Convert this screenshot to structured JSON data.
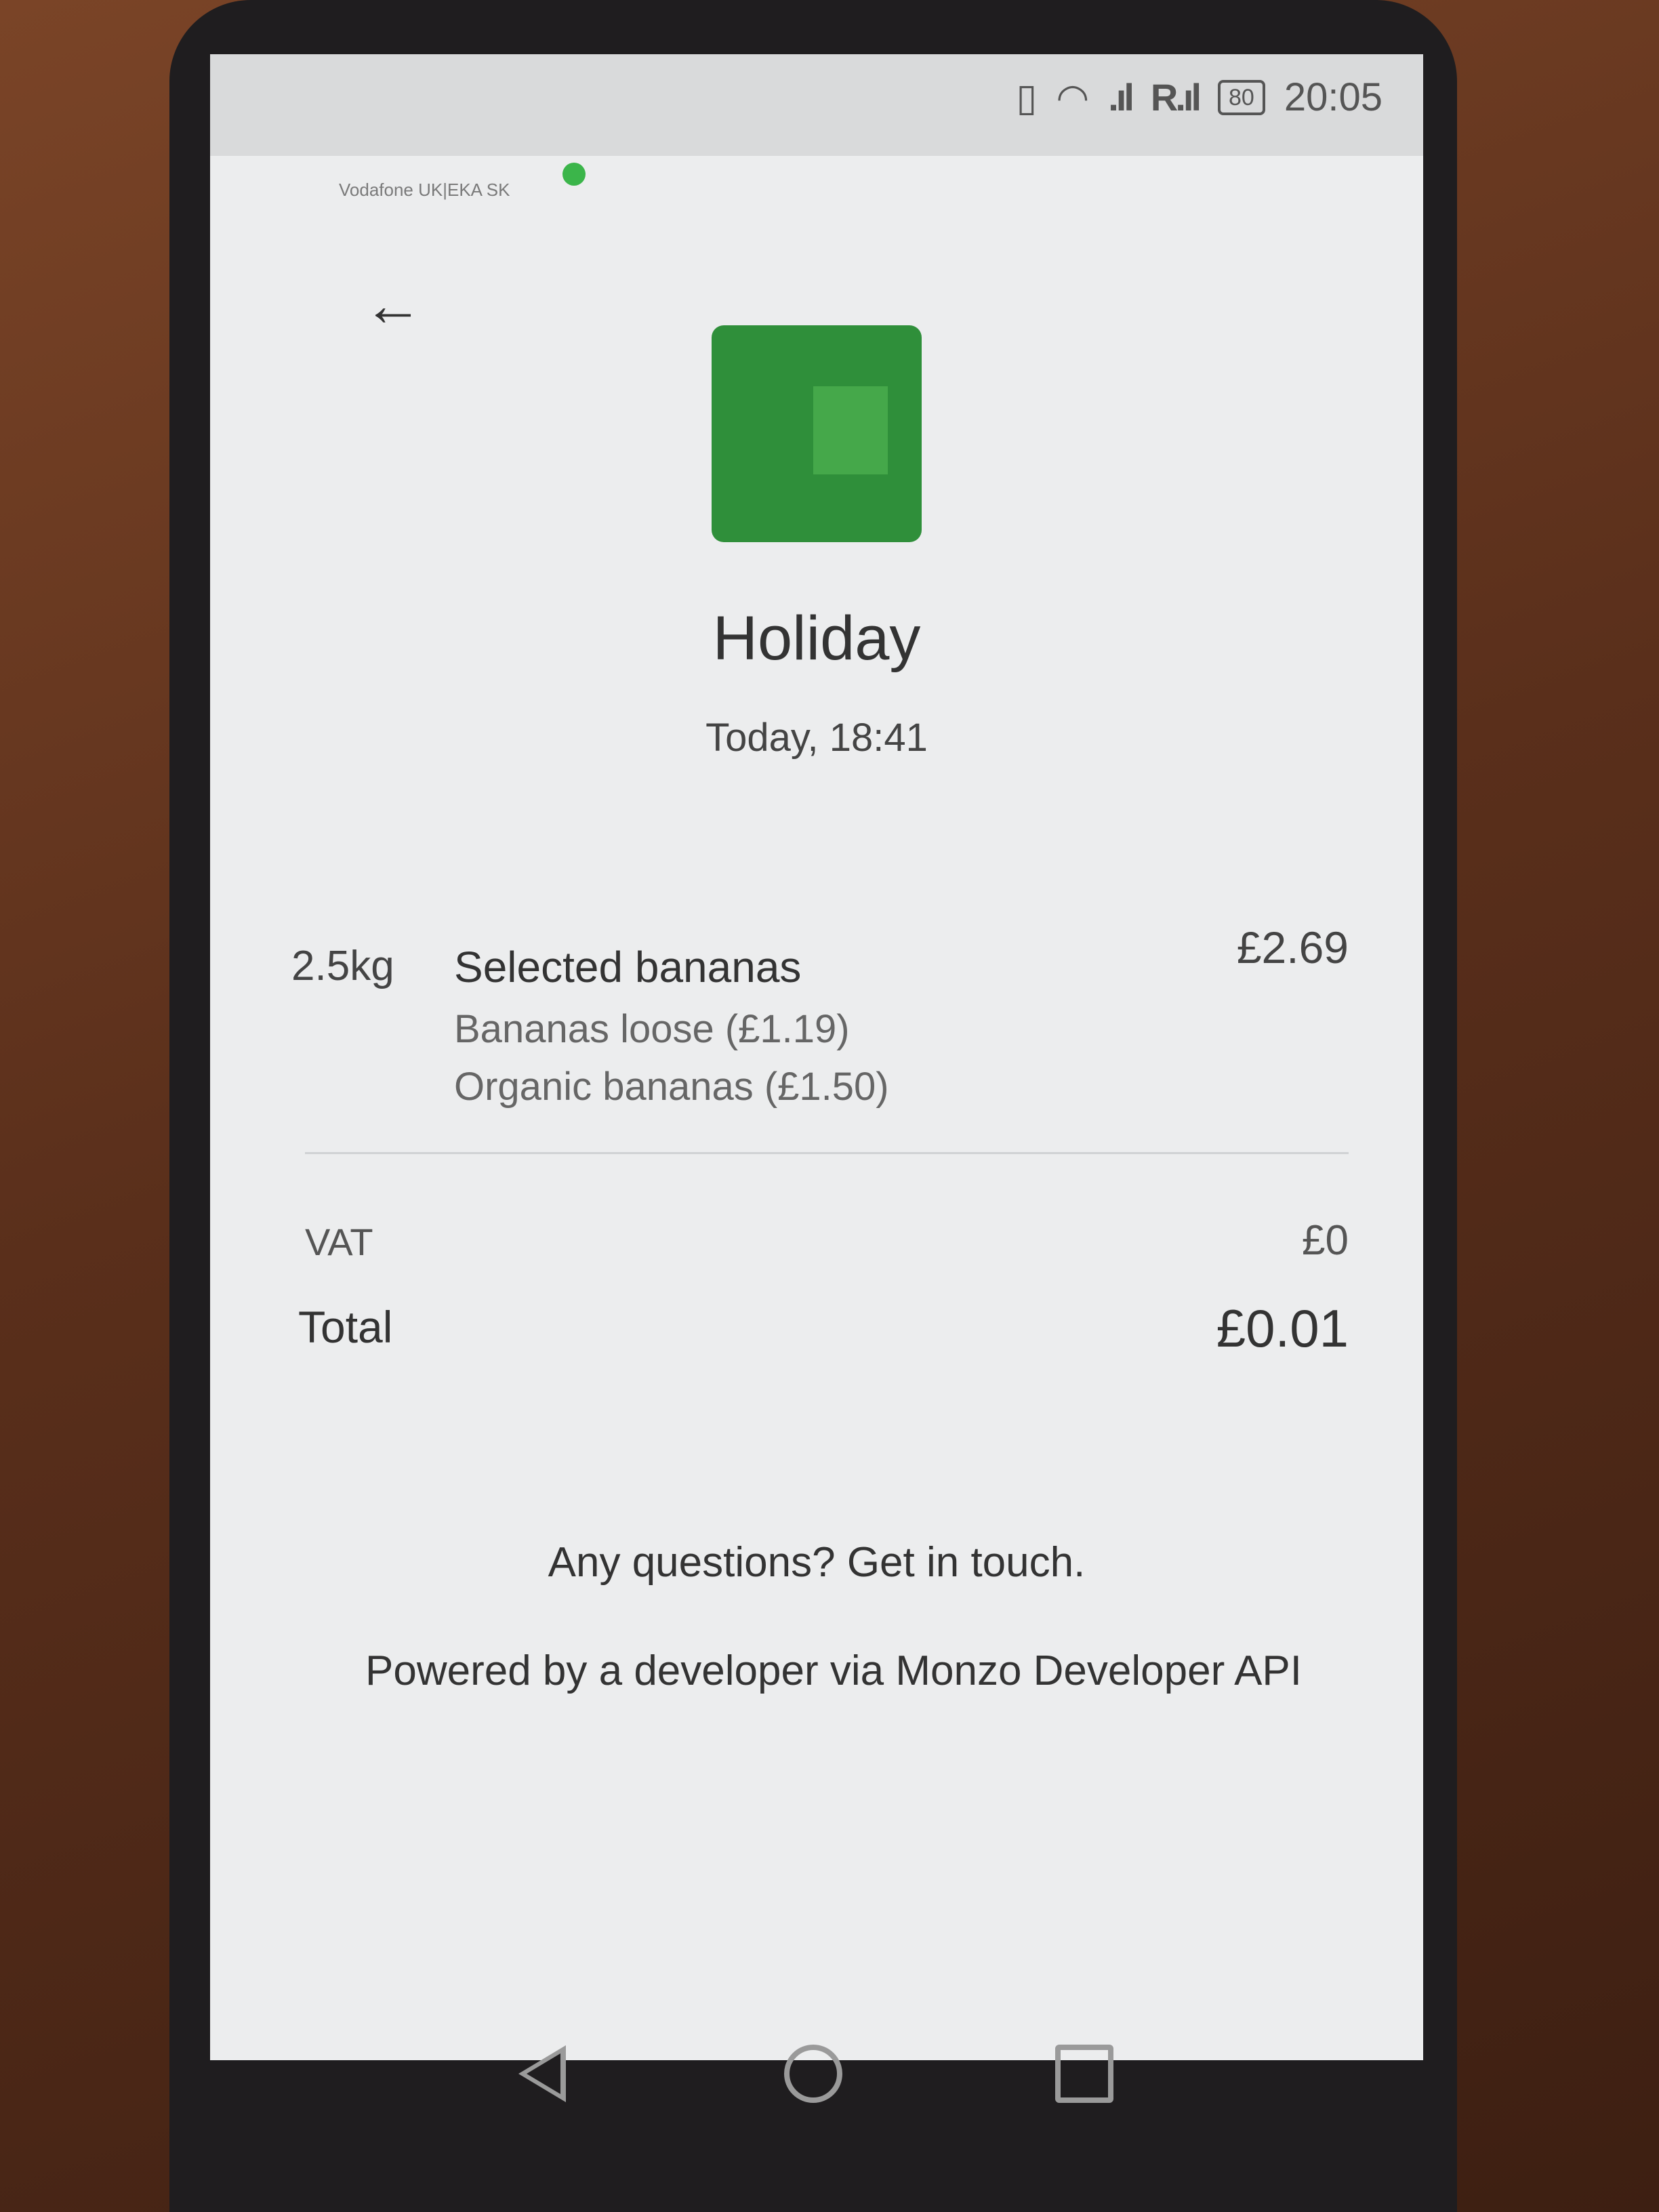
{
  "status_bar": {
    "carrier": "Vodafone UK|EKA SK",
    "battery": "80",
    "time": "20:05",
    "signal_1": ".ıl",
    "signal_2": "R.ıl"
  },
  "receipt": {
    "back_icon": "arrow-left-icon",
    "logo_icon": "merchant-logo-icon",
    "logo_color": "#2f8f3a",
    "merchant_name": "Holiday",
    "timestamp": "Today, 18:41",
    "items": [
      {
        "quantity": "2.5kg",
        "name": "Selected bananas",
        "price": "£2.69",
        "sub_items": [
          "Bananas loose (£1.19)",
          "Organic bananas (£1.50)"
        ]
      }
    ],
    "vat_label": "VAT",
    "vat_value": "£0",
    "total_label": "Total",
    "total_value": "£0.01",
    "contact_text": "Any questions? Get in touch.",
    "powered_by": "Powered by a developer via Monzo Developer API"
  },
  "nav_bar": {
    "back_icon": "triangle-back-icon",
    "home_icon": "circle-home-icon",
    "recents_icon": "square-recents-icon"
  }
}
